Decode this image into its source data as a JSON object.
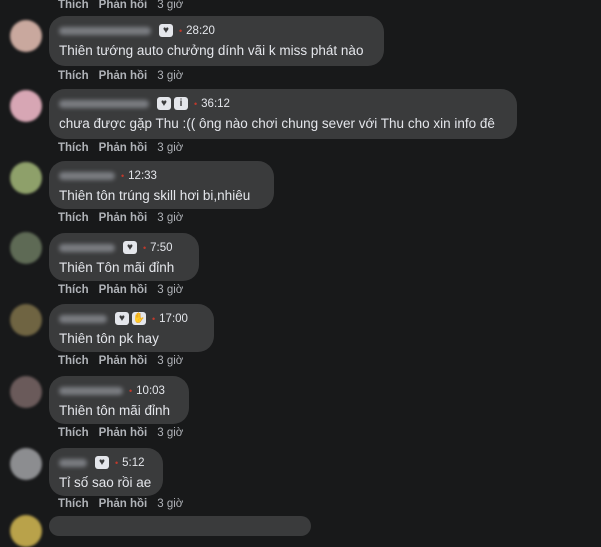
{
  "labels": {
    "like": "Thích",
    "reply": "Phản hồi",
    "time": "3 giờ"
  },
  "comments": [
    {
      "stamp": "28:20",
      "text": "Thiên tướng auto chưởng dính vãi k miss phát nào",
      "icons": [
        "heart-icon"
      ]
    },
    {
      "stamp": "36:12",
      "text": "chưa được gặp Thu :(( ông nào chơi chung sever với Thu cho xin info đê",
      "icons": [
        "heart-icon",
        "info-icon"
      ]
    },
    {
      "stamp": "12:33",
      "text": "Thiên tôn trúng skill hơi bi,nhiêu",
      "icons": []
    },
    {
      "stamp": "7:50",
      "text": "Thiên Tôn mãi đỉnh",
      "icons": [
        "heart-icon"
      ]
    },
    {
      "stamp": "17:00",
      "text": "Thiên tôn pk hay",
      "icons": [
        "heart-icon",
        "clap-icon"
      ]
    },
    {
      "stamp": "10:03",
      "text": "Thiên tôn mãi đỉnh",
      "icons": []
    },
    {
      "stamp": "5:12",
      "text": "Tỉ số sao rồi ae",
      "icons": [
        "heart-icon"
      ]
    }
  ]
}
